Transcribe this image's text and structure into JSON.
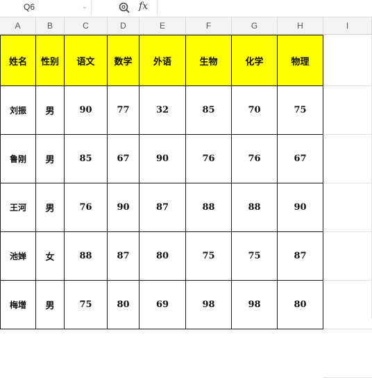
{
  "formula_bar": {
    "cell_ref": "Q6",
    "dropdown_icon": "chevron-down-icon",
    "zoom_icon": "magnifier-icon",
    "fx_label": "fx",
    "formula_value": ""
  },
  "columns": [
    "A",
    "B",
    "C",
    "D",
    "E",
    "F",
    "G",
    "H",
    "I"
  ],
  "table": {
    "headers": [
      "姓名",
      "性别",
      "语文",
      "数学",
      "外语",
      "生物",
      "化学",
      "物理"
    ],
    "rows": [
      [
        "刘振",
        "男",
        "90",
        "77",
        "32",
        "85",
        "70",
        "75"
      ],
      [
        "鲁刚",
        "男",
        "85",
        "67",
        "90",
        "76",
        "76",
        "67"
      ],
      [
        "王河",
        "男",
        "76",
        "90",
        "87",
        "88",
        "88",
        "90"
      ],
      [
        "池婵",
        "女",
        "88",
        "87",
        "80",
        "75",
        "75",
        "87"
      ],
      [
        "梅增",
        "男",
        "75",
        "80",
        "69",
        "98",
        "98",
        "80"
      ]
    ]
  },
  "colors": {
    "header_fill": "#ffff00",
    "grid_header_bg": "#f3f3f3",
    "border": "#1a1a1a"
  }
}
